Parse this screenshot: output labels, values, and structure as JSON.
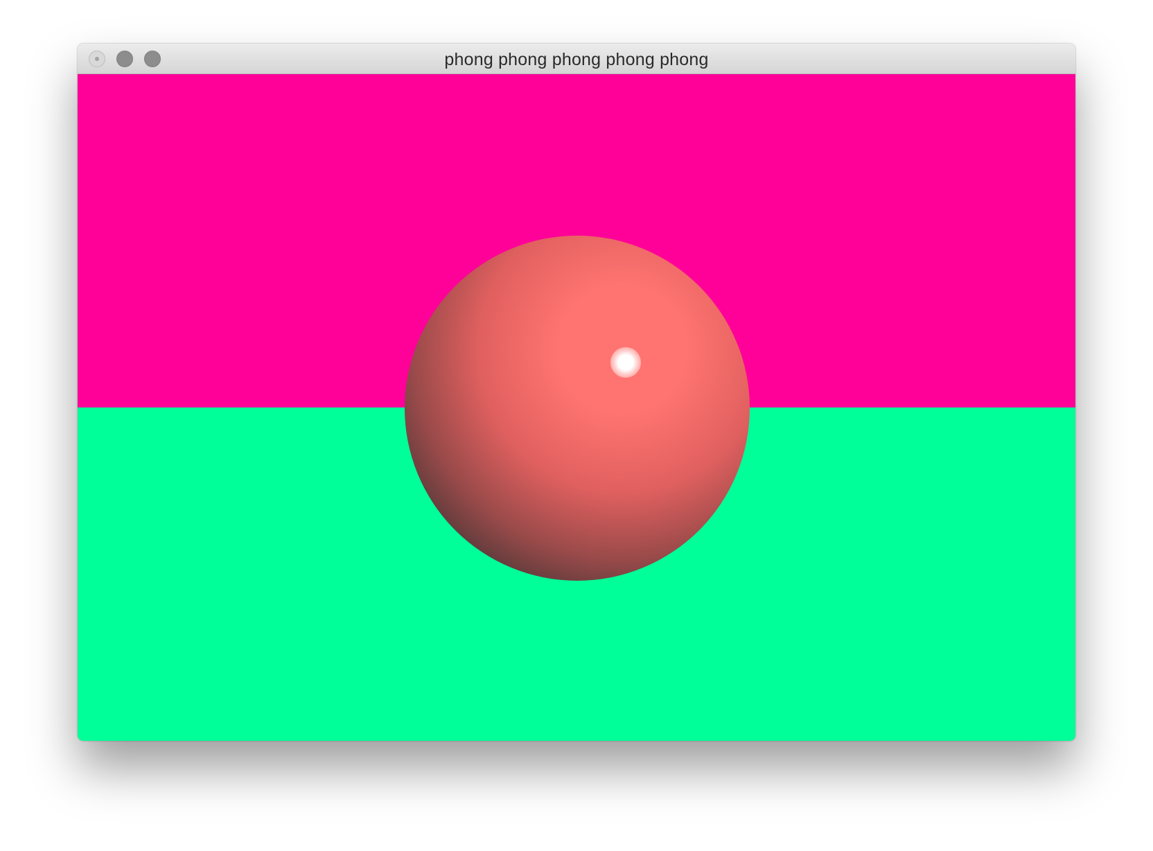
{
  "window": {
    "title": "phong phong phong phong phong"
  },
  "scene": {
    "sky_color": "#ff0099",
    "ground_color": "#00ff99",
    "sphere": {
      "lit_color": "#ff7470",
      "mid_color": "#e0605f",
      "dark_color": "#2f2f2f",
      "highlight_color": "#ffffff"
    }
  },
  "icons": {
    "close": "close-button-inactive",
    "minimize": "minimize-button-inactive",
    "zoom": "zoom-button-inactive"
  }
}
